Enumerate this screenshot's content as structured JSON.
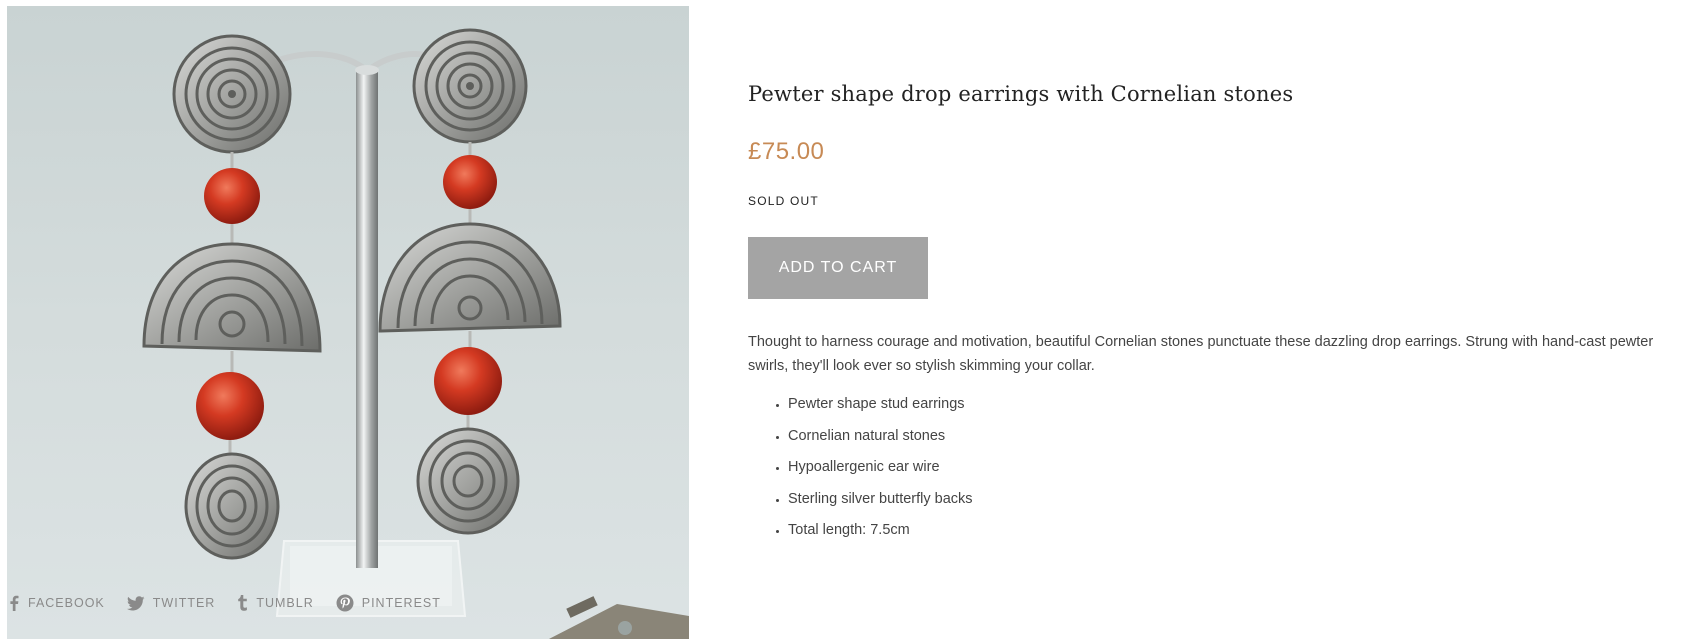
{
  "product": {
    "image_alt": "Pewter spiral drop earrings with red Cornelian beads on a display stand",
    "title": "Pewter shape drop earrings with Cornelian stones",
    "price": "£75.00",
    "stock_status": "SOLD OUT",
    "add_to_cart_label": "ADD TO CART",
    "description": "Thought to harness courage and motivation, beautiful Cornelian stones punctuate these dazzling drop earrings. Strung with hand-cast pewter swirls, they'll look ever so stylish skimming your collar.",
    "features": [
      "Pewter shape stud earrings",
      "Cornelian natural stones",
      "Hypoallergenic ear wire",
      "Sterling silver butterfly backs",
      "Total length: 7.5cm"
    ]
  },
  "share": {
    "facebook": {
      "label": "FACEBOOK",
      "icon": "facebook-icon"
    },
    "twitter": {
      "label": "TWITTER",
      "icon": "twitter-icon"
    },
    "tumblr": {
      "label": "TUMBLR",
      "icon": "tumblr-icon"
    },
    "pinterest": {
      "label": "PINTEREST",
      "icon": "pinterest-icon"
    }
  },
  "colors": {
    "price": "#c78a55",
    "button_bg": "#a4a4a4",
    "share_text": "#8a8a8a"
  }
}
